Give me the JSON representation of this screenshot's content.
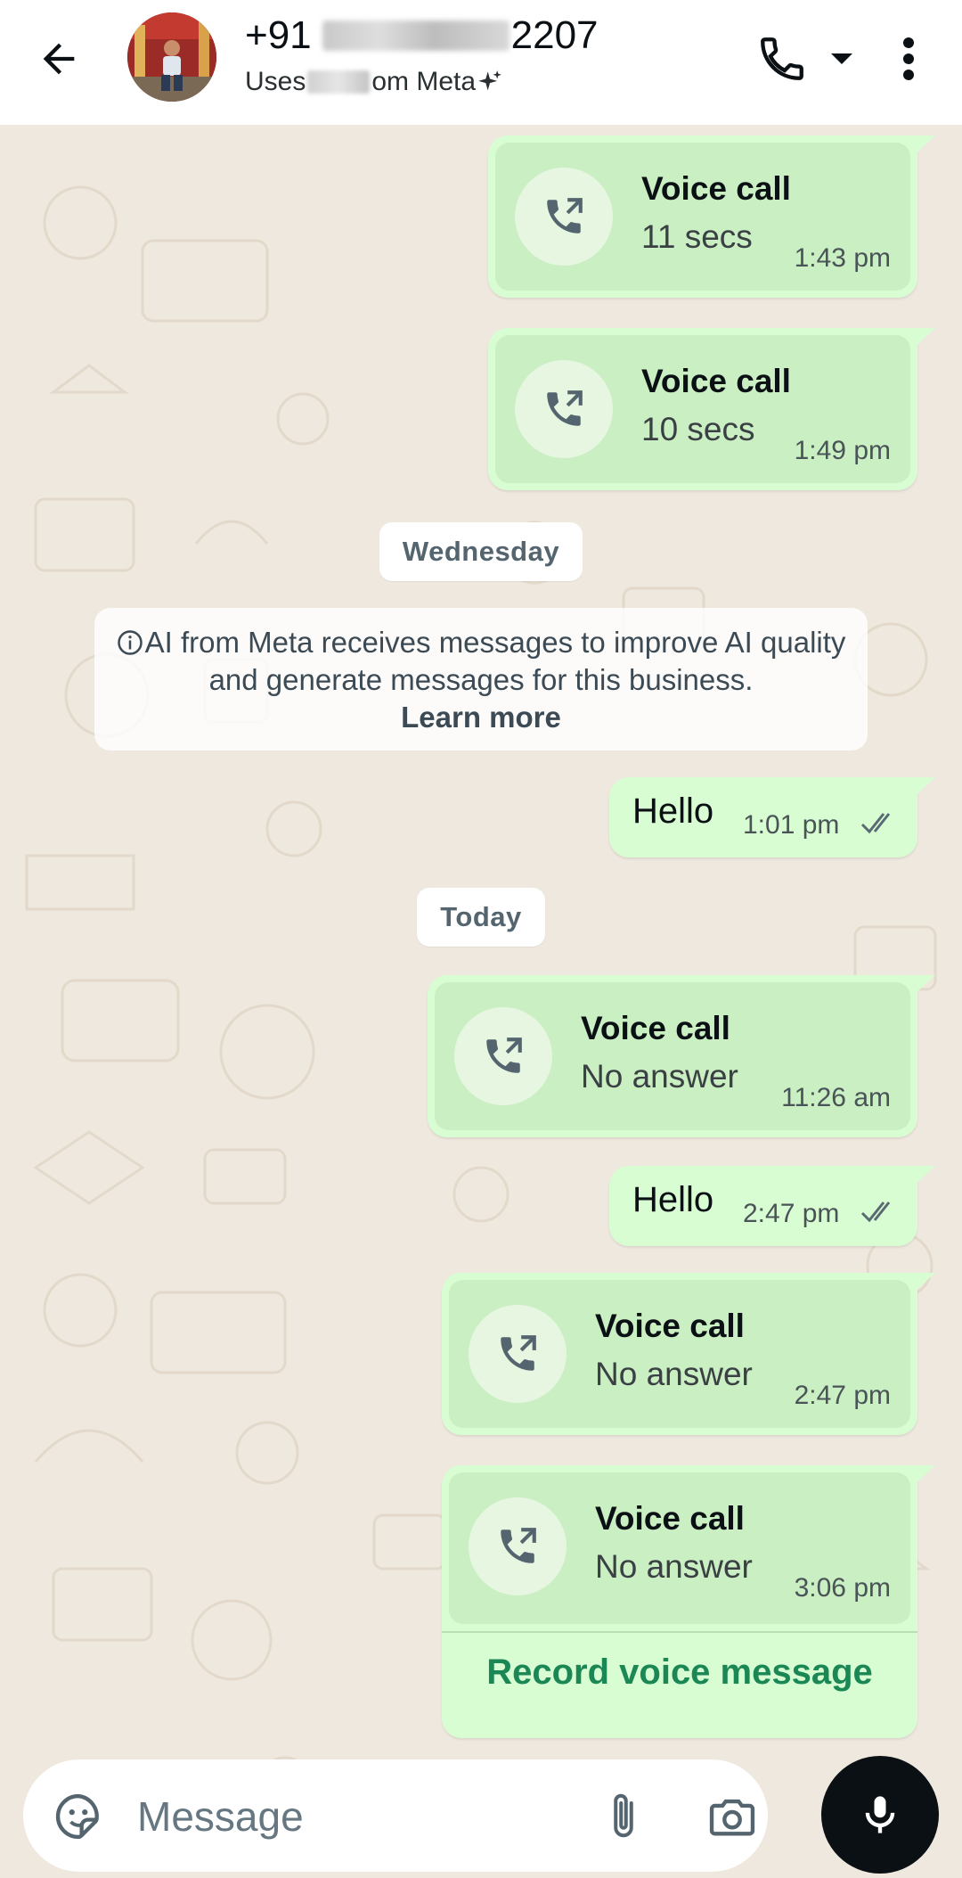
{
  "header": {
    "phone_prefix": "+91",
    "phone_suffix": "2207",
    "subtitle_prefix": "Uses",
    "subtitle_suffix": "om Meta",
    "icons": [
      "back-arrow-icon",
      "phone-icon",
      "caret-down-icon",
      "more-vertical-icon"
    ]
  },
  "messages": [
    {
      "type": "call",
      "title": "Voice call",
      "detail": "11 secs",
      "time": "1:43 pm"
    },
    {
      "type": "call",
      "title": "Voice call",
      "detail": "10 secs",
      "time": "1:49 pm"
    },
    {
      "type": "date",
      "label": "Wednesday"
    },
    {
      "type": "notice",
      "text": "AI from Meta receives messages to improve AI quality and generate messages for this business.",
      "link": "Learn more"
    },
    {
      "type": "text",
      "text": "Hello",
      "time": "1:01 pm"
    },
    {
      "type": "date",
      "label": "Today"
    },
    {
      "type": "call",
      "title": "Voice call",
      "detail": "No answer",
      "time": "11:26 am"
    },
    {
      "type": "text",
      "text": "Hello",
      "time": "2:47 pm"
    },
    {
      "type": "call",
      "title": "Voice call",
      "detail": "No answer",
      "time": "2:47 pm"
    },
    {
      "type": "call",
      "title": "Voice call",
      "detail": "No answer",
      "time": "3:06 pm",
      "action": "Record voice message"
    }
  ],
  "input": {
    "placeholder": "Message"
  },
  "colors": {
    "outgoing_bubble": "#d9fdd3",
    "call_card": "#c9efc2",
    "link_green": "#1a8754",
    "chat_background": "#efe8de",
    "mic_button": "#0b1014"
  }
}
